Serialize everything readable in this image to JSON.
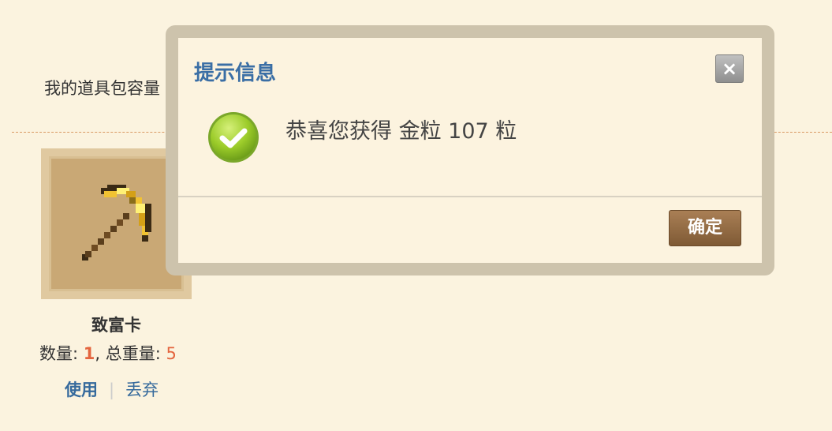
{
  "inventory": {
    "capacity_label": "我的道具包容量",
    "item": {
      "name": "致富卡",
      "icon": "golden-pickaxe-icon",
      "quantity_label": "数量: ",
      "quantity_value": "1",
      "weight_label": ", 总重量: ",
      "weight_value": "5",
      "use_label": "使用",
      "separator": "|",
      "discard_label": "丢弃"
    }
  },
  "dialog": {
    "title": "提示信息",
    "close_label": "×",
    "message": "恭喜您获得 金粒 107 粒",
    "ok_label": "确定",
    "icon": "success-check-icon"
  },
  "colors": {
    "background": "#fbf3df",
    "title_blue": "#3a6ea5",
    "link_blue": "#366a9c",
    "accent_orange": "#e4653f",
    "ok_button": "#8b6440"
  }
}
